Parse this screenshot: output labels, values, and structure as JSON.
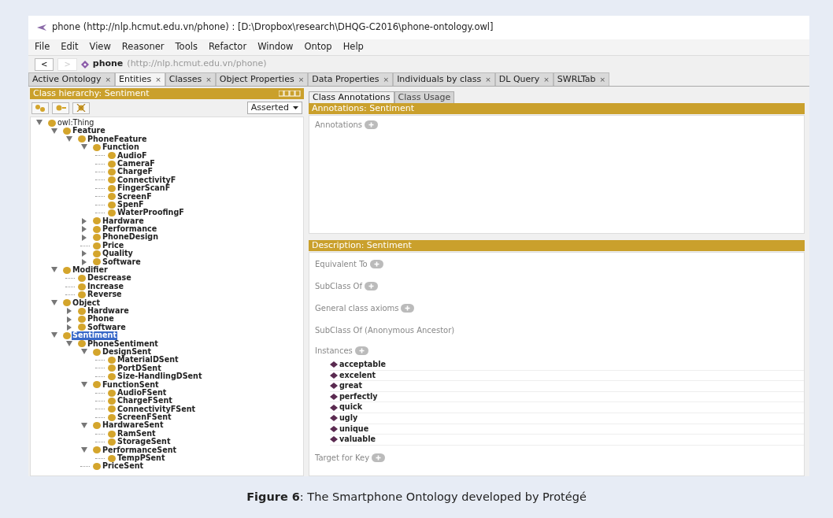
{
  "window": {
    "title": "phone (http://nlp.hcmut.edu.vn/phone)  : [D:\\Dropbox\\research\\DHQG-C2016\\phone-ontology.owl]"
  },
  "menu": [
    "File",
    "Edit",
    "View",
    "Reasoner",
    "Tools",
    "Refactor",
    "Window",
    "Ontop",
    "Help"
  ],
  "nav_bar": {
    "back": "<",
    "forward": ">",
    "forward_disabled": true,
    "ontology_name": "phone",
    "ontology_iri": "(http://nlp.hcmut.edu.vn/phone)"
  },
  "tabs": [
    {
      "label": "Active Ontology",
      "close": "×",
      "selected": false
    },
    {
      "label": "Entities",
      "close": "×",
      "selected": true
    },
    {
      "label": "Classes",
      "close": "×",
      "selected": false
    },
    {
      "label": "Object Properties",
      "close": "×",
      "selected": false
    },
    {
      "label": "Data Properties",
      "close": "×",
      "selected": false
    },
    {
      "label": "Individuals by class",
      "close": "×",
      "selected": false
    },
    {
      "label": "DL Query",
      "close": "×",
      "selected": false
    },
    {
      "label": "SWRLTab",
      "close": "×",
      "selected": false
    }
  ],
  "class_hierarchy": {
    "title": "Class hierarchy: Sentiment",
    "mode": "Asserted",
    "tree": [
      {
        "label": "owl:Thing",
        "kind": "branch",
        "expanded": true,
        "selected": false,
        "children": [
          {
            "label": "Feature",
            "kind": "branch",
            "expanded": true,
            "selected": false,
            "children": [
              {
                "label": "PhoneFeature",
                "kind": "branch",
                "expanded": true,
                "selected": false,
                "children": [
                  {
                    "label": "Function",
                    "kind": "branch",
                    "expanded": true,
                    "selected": false,
                    "children": [
                      {
                        "label": "AudioF",
                        "kind": "leaf",
                        "selected": false
                      },
                      {
                        "label": "CameraF",
                        "kind": "leaf",
                        "selected": false
                      },
                      {
                        "label": "ChargeF",
                        "kind": "leaf",
                        "selected": false
                      },
                      {
                        "label": "ConnectivityF",
                        "kind": "leaf",
                        "selected": false
                      },
                      {
                        "label": "FingerScanF",
                        "kind": "leaf",
                        "selected": false
                      },
                      {
                        "label": "ScreenF",
                        "kind": "leaf",
                        "selected": false
                      },
                      {
                        "label": "SpenF",
                        "kind": "leaf",
                        "selected": false
                      },
                      {
                        "label": "WaterProofingF",
                        "kind": "leaf",
                        "selected": false
                      }
                    ]
                  },
                  {
                    "label": "Hardware",
                    "kind": "branch",
                    "expanded": false,
                    "selected": false
                  },
                  {
                    "label": "Performance",
                    "kind": "branch",
                    "expanded": false,
                    "selected": false
                  },
                  {
                    "label": "PhoneDesign",
                    "kind": "branch",
                    "expanded": false,
                    "selected": false
                  },
                  {
                    "label": "Price",
                    "kind": "leaf",
                    "selected": false
                  },
                  {
                    "label": "Quality",
                    "kind": "branch",
                    "expanded": false,
                    "selected": false
                  },
                  {
                    "label": "Software",
                    "kind": "branch",
                    "expanded": false,
                    "selected": false
                  }
                ]
              }
            ]
          },
          {
            "label": "Modifier",
            "kind": "branch",
            "expanded": true,
            "selected": false,
            "children": [
              {
                "label": "Descrease",
                "kind": "leaf",
                "selected": false
              },
              {
                "label": "Increase",
                "kind": "leaf",
                "selected": false
              },
              {
                "label": "Reverse",
                "kind": "leaf",
                "selected": false
              }
            ]
          },
          {
            "label": "Object",
            "kind": "branch",
            "expanded": true,
            "selected": false,
            "children": [
              {
                "label": "Hardware",
                "kind": "branch",
                "expanded": false,
                "selected": false
              },
              {
                "label": "Phone",
                "kind": "branch",
                "expanded": false,
                "selected": false
              },
              {
                "label": "Software",
                "kind": "branch",
                "expanded": false,
                "selected": false
              }
            ]
          },
          {
            "label": "Sentiment",
            "kind": "branch",
            "expanded": true,
            "selected": true,
            "children": [
              {
                "label": "PhoneSentiment",
                "kind": "branch",
                "expanded": true,
                "selected": false,
                "children": [
                  {
                    "label": "DesignSent",
                    "kind": "branch",
                    "expanded": true,
                    "selected": false,
                    "children": [
                      {
                        "label": "MaterialDSent",
                        "kind": "leaf",
                        "selected": false
                      },
                      {
                        "label": "PortDSent",
                        "kind": "leaf",
                        "selected": false
                      },
                      {
                        "label": "Size-HandlingDSent",
                        "kind": "leaf",
                        "selected": false
                      }
                    ]
                  },
                  {
                    "label": "FunctionSent",
                    "kind": "branch",
                    "expanded": true,
                    "selected": false,
                    "children": [
                      {
                        "label": "AudioFSent",
                        "kind": "leaf",
                        "selected": false
                      },
                      {
                        "label": "ChargeFSent",
                        "kind": "leaf",
                        "selected": false
                      },
                      {
                        "label": "ConnectivityFSent",
                        "kind": "leaf",
                        "selected": false
                      },
                      {
                        "label": "ScreenFSent",
                        "kind": "leaf",
                        "selected": false
                      }
                    ]
                  },
                  {
                    "label": "HardwareSent",
                    "kind": "branch",
                    "expanded": true,
                    "selected": false,
                    "children": [
                      {
                        "label": "RamSent",
                        "kind": "leaf",
                        "selected": false
                      },
                      {
                        "label": "StorageSent",
                        "kind": "leaf",
                        "selected": false
                      }
                    ]
                  },
                  {
                    "label": "PerformanceSent",
                    "kind": "branch",
                    "expanded": true,
                    "selected": false,
                    "children": [
                      {
                        "label": "TempPSent",
                        "kind": "leaf",
                        "selected": false
                      }
                    ]
                  },
                  {
                    "label": "PriceSent",
                    "kind": "leaf",
                    "selected": false
                  }
                ]
              }
            ]
          }
        ]
      }
    ]
  },
  "detail_tabs": [
    {
      "label": "Class Annotations",
      "selected": true
    },
    {
      "label": "Class Usage",
      "selected": false
    }
  ],
  "annotations": {
    "title": "Annotations: Sentiment",
    "label": "Annotations"
  },
  "description": {
    "title": "Description: Sentiment",
    "sections": [
      {
        "label": "Equivalent To",
        "addable": true
      },
      {
        "label": "SubClass Of",
        "addable": true
      },
      {
        "label": "General class axioms",
        "addable": true
      },
      {
        "label": "SubClass Of (Anonymous Ancestor)",
        "addable": false
      },
      {
        "label": "Instances",
        "addable": true,
        "items": [
          "acceptable",
          "excelent",
          "great",
          "perfectly",
          "quick",
          "ugly",
          "unique",
          "valuable"
        ]
      },
      {
        "label": "Target for Key",
        "addable": true
      }
    ]
  },
  "caption": "**Figure 6**: The Smartphone Ontology developed by Protégé"
}
